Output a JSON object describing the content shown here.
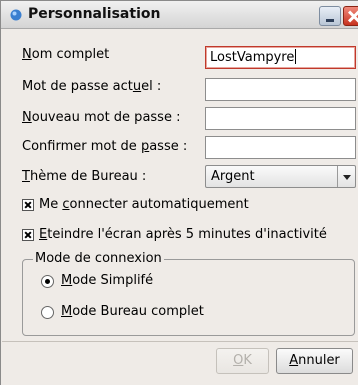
{
  "window": {
    "title": "Personnalisation"
  },
  "form": {
    "full_name_label_u": "N",
    "full_name_label_rest": "om complet",
    "full_name_value": "LostVampyre",
    "current_password_label_pre": "Mot de passe act",
    "current_password_label_u": "u",
    "current_password_label_post": "el :",
    "new_password_label_u": "N",
    "new_password_label_rest": "ouveau mot de passe :",
    "confirm_password_label_pre": "Confirmer mot de ",
    "confirm_password_label_u": "p",
    "confirm_password_label_post": "asse :",
    "desktop_theme_label_u": "T",
    "desktop_theme_label_rest": "hème de Bureau :",
    "desktop_theme_value": "Argent"
  },
  "options": {
    "auto_login_pre": "Me ",
    "auto_login_u": "c",
    "auto_login_post": "onnecter automatiquement",
    "auto_login_checked": true,
    "screen_off_u": "E",
    "screen_off_rest": "teindre l'écran après 5 minutes d'inactivité",
    "screen_off_checked": true
  },
  "connection_mode": {
    "legend": "Mode de connexion",
    "simple_u": "M",
    "simple_rest": "ode Simplifé",
    "simple_selected": true,
    "full_u": "M",
    "full_rest": "ode Bureau complet",
    "full_selected": false
  },
  "buttons": {
    "ok_u": "O",
    "ok_rest": "K",
    "ok_enabled": false,
    "cancel_u": "A",
    "cancel_rest": "nnuler"
  },
  "colors": {
    "title_icon": "#3a7fd0",
    "active_field_border": "#c0392b",
    "close_button": "#d1432e"
  },
  "icons": {
    "title": "app-globe-icon",
    "minimize": "minimize-icon",
    "close": "close-icon",
    "dropdown": "chevron-down-icon"
  }
}
